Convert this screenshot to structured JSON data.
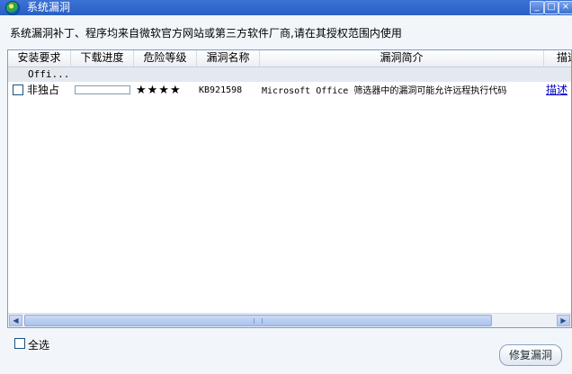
{
  "window": {
    "title": "系统漏洞",
    "minimize_label": "_",
    "maximize_label": "□",
    "close_label": "×"
  },
  "description": "系统漏洞补丁、程序均来自微软官方网站或第三方软件厂商,请在其授权范围内使用",
  "table": {
    "columns": [
      "安装要求",
      "下载进度",
      "危险等级",
      "漏洞名称",
      "漏洞简介",
      "描述"
    ],
    "group_label": "Offi...",
    "rows": [
      {
        "requirement": "非独占",
        "progress": 0,
        "rating": "★★★★",
        "name": "KB921598",
        "summary": "Microsoft Office 筛选器中的漏洞可能允许远程执行代码",
        "description_link": "描述"
      }
    ]
  },
  "scrollbar": {
    "left_arrow": "◀",
    "right_arrow": "▶"
  },
  "footer": {
    "select_all_label": "全选",
    "fix_button_label": "修复漏洞"
  },
  "colors": {
    "titlebar": "#2a5fc4",
    "background": "#f2f6fb",
    "link": "#0000cc"
  }
}
